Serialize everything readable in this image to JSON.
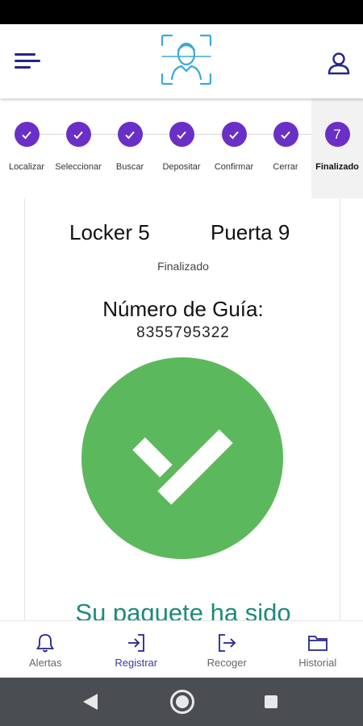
{
  "header": {
    "menu_icon": "hamburger-menu-icon",
    "logo_icon": "face-scan-icon",
    "profile_icon": "user-profile-icon",
    "accent_color": "#23238f"
  },
  "stepper": {
    "completed_color": "#6a2fc6",
    "steps": [
      {
        "label": "Localizar",
        "state": "completed",
        "icon": "check-icon"
      },
      {
        "label": "Seleccionar",
        "state": "completed",
        "icon": "check-icon"
      },
      {
        "label": "Buscar",
        "state": "completed",
        "icon": "check-icon"
      },
      {
        "label": "Depositar",
        "state": "completed",
        "icon": "check-icon"
      },
      {
        "label": "Confirmar",
        "state": "completed",
        "icon": "check-icon"
      },
      {
        "label": "Cerrar",
        "state": "completed",
        "icon": "check-icon"
      },
      {
        "label": "Finalizado",
        "state": "active",
        "number": "7"
      }
    ]
  },
  "card": {
    "locker": "Locker 5",
    "door": "Puerta 9",
    "status": "Finalizado",
    "guide_title": "Número de Guía:",
    "guide_number": "8355795322",
    "success_icon": "success-check-icon",
    "success_color": "#5cb85c",
    "message": "Su paquete ha sido"
  },
  "bottom_nav": {
    "items": [
      {
        "label": "Alertas",
        "icon": "bell-icon"
      },
      {
        "label": "Registrar",
        "icon": "sign-in-icon",
        "selected": true
      },
      {
        "label": "Recoger",
        "icon": "sign-out-icon"
      },
      {
        "label": "Historial",
        "icon": "folder-icon"
      }
    ]
  },
  "system_nav": {
    "back_icon": "back-triangle-icon",
    "home_icon": "home-circle-icon",
    "recent_icon": "recent-apps-square-icon"
  }
}
